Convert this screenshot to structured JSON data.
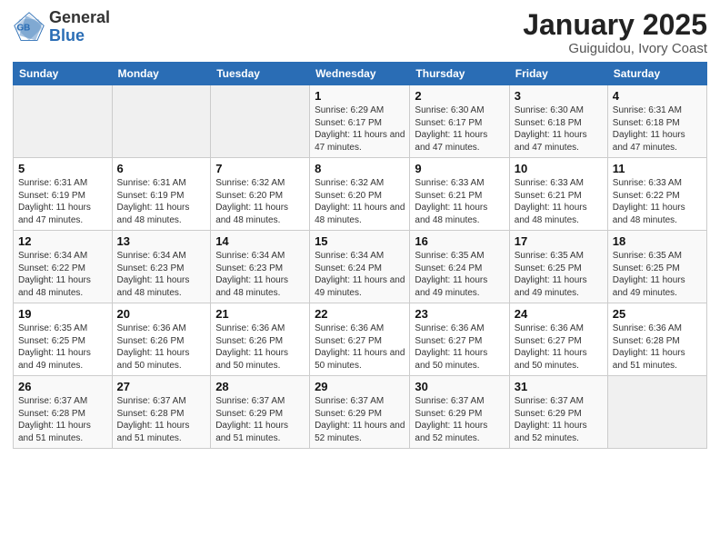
{
  "header": {
    "logo_general": "General",
    "logo_blue": "Blue",
    "title": "January 2025",
    "subtitle": "Guiguidou, Ivory Coast"
  },
  "calendar": {
    "days_of_week": [
      "Sunday",
      "Monday",
      "Tuesday",
      "Wednesday",
      "Thursday",
      "Friday",
      "Saturday"
    ],
    "weeks": [
      [
        {
          "day": "",
          "info": ""
        },
        {
          "day": "",
          "info": ""
        },
        {
          "day": "",
          "info": ""
        },
        {
          "day": "1",
          "info": "Sunrise: 6:29 AM\nSunset: 6:17 PM\nDaylight: 11 hours and 47 minutes."
        },
        {
          "day": "2",
          "info": "Sunrise: 6:30 AM\nSunset: 6:17 PM\nDaylight: 11 hours and 47 minutes."
        },
        {
          "day": "3",
          "info": "Sunrise: 6:30 AM\nSunset: 6:18 PM\nDaylight: 11 hours and 47 minutes."
        },
        {
          "day": "4",
          "info": "Sunrise: 6:31 AM\nSunset: 6:18 PM\nDaylight: 11 hours and 47 minutes."
        }
      ],
      [
        {
          "day": "5",
          "info": "Sunrise: 6:31 AM\nSunset: 6:19 PM\nDaylight: 11 hours and 47 minutes."
        },
        {
          "day": "6",
          "info": "Sunrise: 6:31 AM\nSunset: 6:19 PM\nDaylight: 11 hours and 48 minutes."
        },
        {
          "day": "7",
          "info": "Sunrise: 6:32 AM\nSunset: 6:20 PM\nDaylight: 11 hours and 48 minutes."
        },
        {
          "day": "8",
          "info": "Sunrise: 6:32 AM\nSunset: 6:20 PM\nDaylight: 11 hours and 48 minutes."
        },
        {
          "day": "9",
          "info": "Sunrise: 6:33 AM\nSunset: 6:21 PM\nDaylight: 11 hours and 48 minutes."
        },
        {
          "day": "10",
          "info": "Sunrise: 6:33 AM\nSunset: 6:21 PM\nDaylight: 11 hours and 48 minutes."
        },
        {
          "day": "11",
          "info": "Sunrise: 6:33 AM\nSunset: 6:22 PM\nDaylight: 11 hours and 48 minutes."
        }
      ],
      [
        {
          "day": "12",
          "info": "Sunrise: 6:34 AM\nSunset: 6:22 PM\nDaylight: 11 hours and 48 minutes."
        },
        {
          "day": "13",
          "info": "Sunrise: 6:34 AM\nSunset: 6:23 PM\nDaylight: 11 hours and 48 minutes."
        },
        {
          "day": "14",
          "info": "Sunrise: 6:34 AM\nSunset: 6:23 PM\nDaylight: 11 hours and 48 minutes."
        },
        {
          "day": "15",
          "info": "Sunrise: 6:34 AM\nSunset: 6:24 PM\nDaylight: 11 hours and 49 minutes."
        },
        {
          "day": "16",
          "info": "Sunrise: 6:35 AM\nSunset: 6:24 PM\nDaylight: 11 hours and 49 minutes."
        },
        {
          "day": "17",
          "info": "Sunrise: 6:35 AM\nSunset: 6:25 PM\nDaylight: 11 hours and 49 minutes."
        },
        {
          "day": "18",
          "info": "Sunrise: 6:35 AM\nSunset: 6:25 PM\nDaylight: 11 hours and 49 minutes."
        }
      ],
      [
        {
          "day": "19",
          "info": "Sunrise: 6:35 AM\nSunset: 6:25 PM\nDaylight: 11 hours and 49 minutes."
        },
        {
          "day": "20",
          "info": "Sunrise: 6:36 AM\nSunset: 6:26 PM\nDaylight: 11 hours and 50 minutes."
        },
        {
          "day": "21",
          "info": "Sunrise: 6:36 AM\nSunset: 6:26 PM\nDaylight: 11 hours and 50 minutes."
        },
        {
          "day": "22",
          "info": "Sunrise: 6:36 AM\nSunset: 6:27 PM\nDaylight: 11 hours and 50 minutes."
        },
        {
          "day": "23",
          "info": "Sunrise: 6:36 AM\nSunset: 6:27 PM\nDaylight: 11 hours and 50 minutes."
        },
        {
          "day": "24",
          "info": "Sunrise: 6:36 AM\nSunset: 6:27 PM\nDaylight: 11 hours and 50 minutes."
        },
        {
          "day": "25",
          "info": "Sunrise: 6:36 AM\nSunset: 6:28 PM\nDaylight: 11 hours and 51 minutes."
        }
      ],
      [
        {
          "day": "26",
          "info": "Sunrise: 6:37 AM\nSunset: 6:28 PM\nDaylight: 11 hours and 51 minutes."
        },
        {
          "day": "27",
          "info": "Sunrise: 6:37 AM\nSunset: 6:28 PM\nDaylight: 11 hours and 51 minutes."
        },
        {
          "day": "28",
          "info": "Sunrise: 6:37 AM\nSunset: 6:29 PM\nDaylight: 11 hours and 51 minutes."
        },
        {
          "day": "29",
          "info": "Sunrise: 6:37 AM\nSunset: 6:29 PM\nDaylight: 11 hours and 52 minutes."
        },
        {
          "day": "30",
          "info": "Sunrise: 6:37 AM\nSunset: 6:29 PM\nDaylight: 11 hours and 52 minutes."
        },
        {
          "day": "31",
          "info": "Sunrise: 6:37 AM\nSunset: 6:29 PM\nDaylight: 11 hours and 52 minutes."
        },
        {
          "day": "",
          "info": ""
        }
      ]
    ]
  }
}
